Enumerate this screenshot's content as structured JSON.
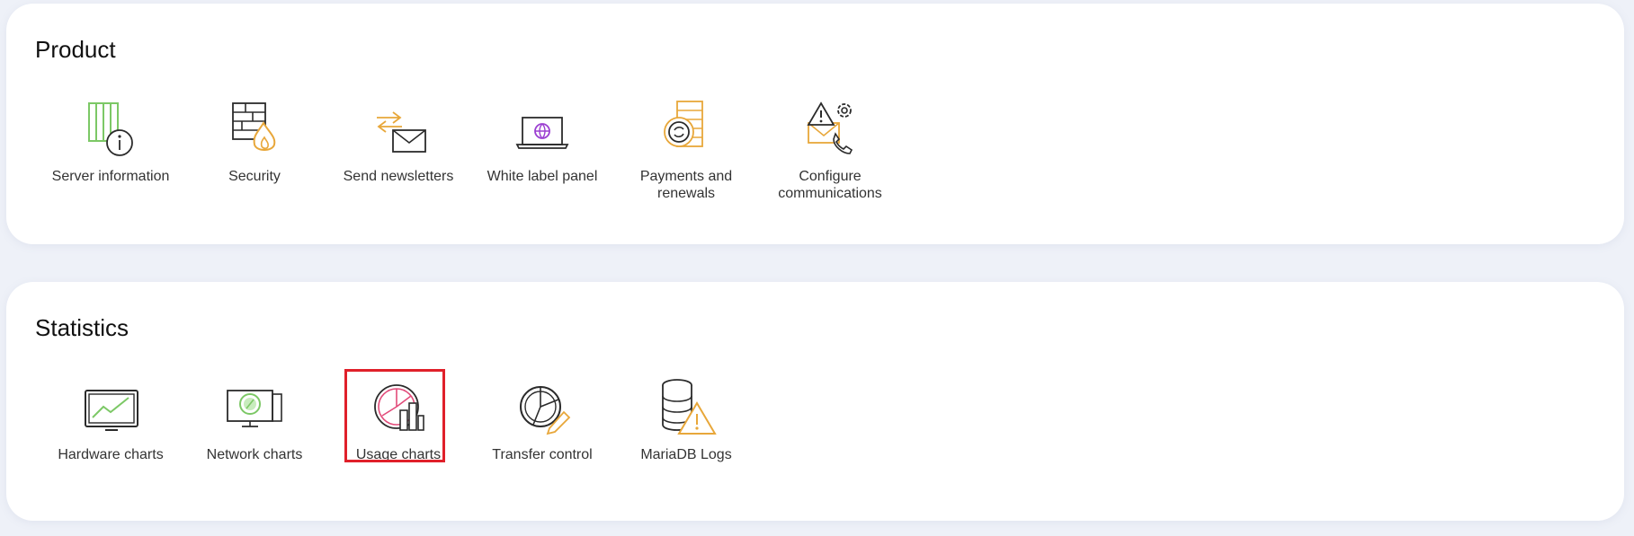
{
  "sections": {
    "product": {
      "title": "Product",
      "items": [
        {
          "label": "Server information",
          "icon": "server-info-icon"
        },
        {
          "label": "Security",
          "icon": "firewall-icon"
        },
        {
          "label": "Send newsletters",
          "icon": "newsletter-icon"
        },
        {
          "label": "White label panel",
          "icon": "laptop-icon"
        },
        {
          "label": "Payments and renewals",
          "icon": "payments-icon"
        },
        {
          "label": "Configure communications",
          "icon": "communications-icon"
        }
      ]
    },
    "statistics": {
      "title": "Statistics",
      "items": [
        {
          "label": "Hardware charts",
          "icon": "hardware-chart-icon"
        },
        {
          "label": "Network charts",
          "icon": "network-chart-icon"
        },
        {
          "label": "Usage charts",
          "icon": "usage-chart-icon",
          "selected": true
        },
        {
          "label": "Transfer control",
          "icon": "transfer-control-icon"
        },
        {
          "label": "MariaDB Logs",
          "icon": "database-warning-icon"
        }
      ]
    }
  },
  "colors": {
    "green": "#7cc866",
    "orange": "#e8a73a",
    "purple": "#9b3fd1",
    "pink": "#e24b7a",
    "dark": "#2b2b2b",
    "highlight": "#e0202a"
  }
}
